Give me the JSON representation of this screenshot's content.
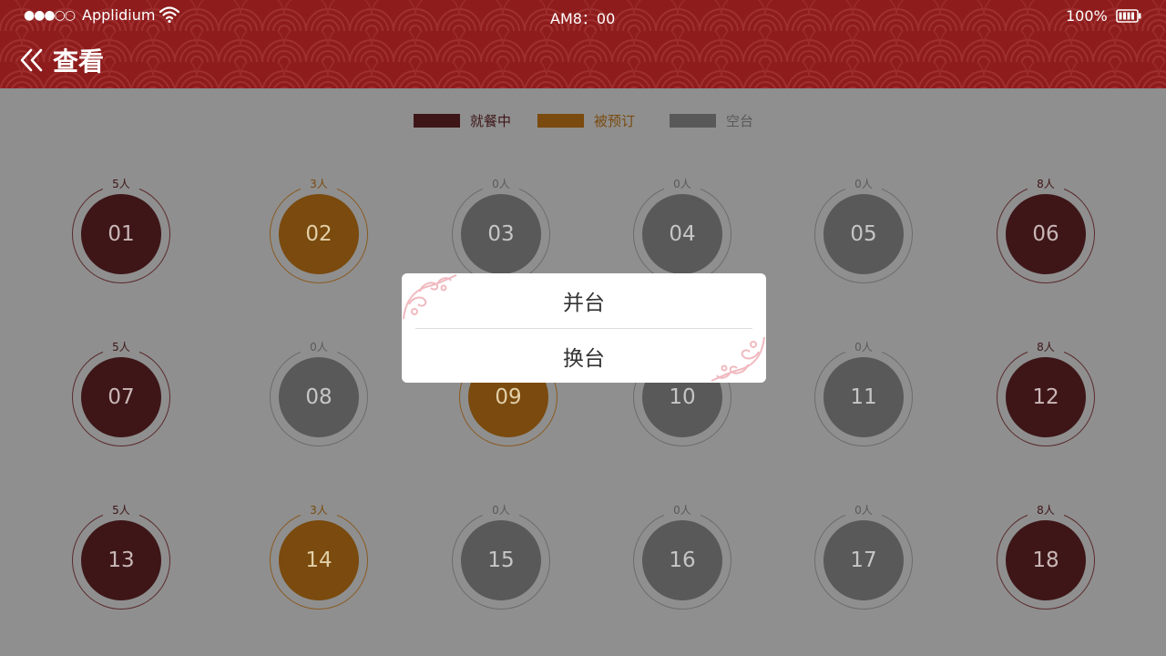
{
  "status": {
    "signal": "●●●○○",
    "carrier": "Applidium",
    "time": "AM8：00",
    "battery": "100%"
  },
  "header": {
    "title": "查看",
    "back_icon": "double-chevron-left-icon",
    "color": "#8e1c1c"
  },
  "legend": [
    {
      "label": "就餐中",
      "color": "#3e1618",
      "text_color": "#3e1618"
    },
    {
      "label": "被预订",
      "color": "#7a4a0e",
      "text_color": "#7a4a0e"
    },
    {
      "label": "空台",
      "color": "#595959",
      "text_color": "#595959"
    }
  ],
  "tables": [
    {
      "number": "01",
      "count": "5人",
      "status": "dining"
    },
    {
      "number": "02",
      "count": "3人",
      "status": "reserved"
    },
    {
      "number": "03",
      "count": "0人",
      "status": "empty"
    },
    {
      "number": "04",
      "count": "0人",
      "status": "empty"
    },
    {
      "number": "05",
      "count": "0人",
      "status": "empty"
    },
    {
      "number": "06",
      "count": "8人",
      "status": "dining"
    },
    {
      "number": "07",
      "count": "5人",
      "status": "dining"
    },
    {
      "number": "08",
      "count": "0人",
      "status": "empty"
    },
    {
      "number": "09",
      "count": "",
      "status": "reserved"
    },
    {
      "number": "10",
      "count": "",
      "status": "empty"
    },
    {
      "number": "11",
      "count": "0人",
      "status": "empty"
    },
    {
      "number": "12",
      "count": "8人",
      "status": "dining"
    },
    {
      "number": "13",
      "count": "5人",
      "status": "dining"
    },
    {
      "number": "14",
      "count": "3人",
      "status": "reserved"
    },
    {
      "number": "15",
      "count": "0人",
      "status": "empty"
    },
    {
      "number": "16",
      "count": "0人",
      "status": "empty"
    },
    {
      "number": "17",
      "count": "0人",
      "status": "empty"
    },
    {
      "number": "18",
      "count": "8人",
      "status": "dining"
    }
  ],
  "status_colors": {
    "dining": {
      "disc": "#3e1618",
      "ring": "#5a2a2c",
      "text": "#c9b7b7",
      "count": "#3e1618"
    },
    "reserved": {
      "disc": "#7a4a0e",
      "ring": "#8a5a20",
      "text": "#e2cfa8",
      "count": "#7a4a0e"
    },
    "empty": {
      "disc": "#595959",
      "ring": "#6c6c6c",
      "text": "#c6c6c6",
      "count": "#5a5a5a"
    }
  },
  "dialog": {
    "merge_label": "并台",
    "change_label": "换台"
  }
}
